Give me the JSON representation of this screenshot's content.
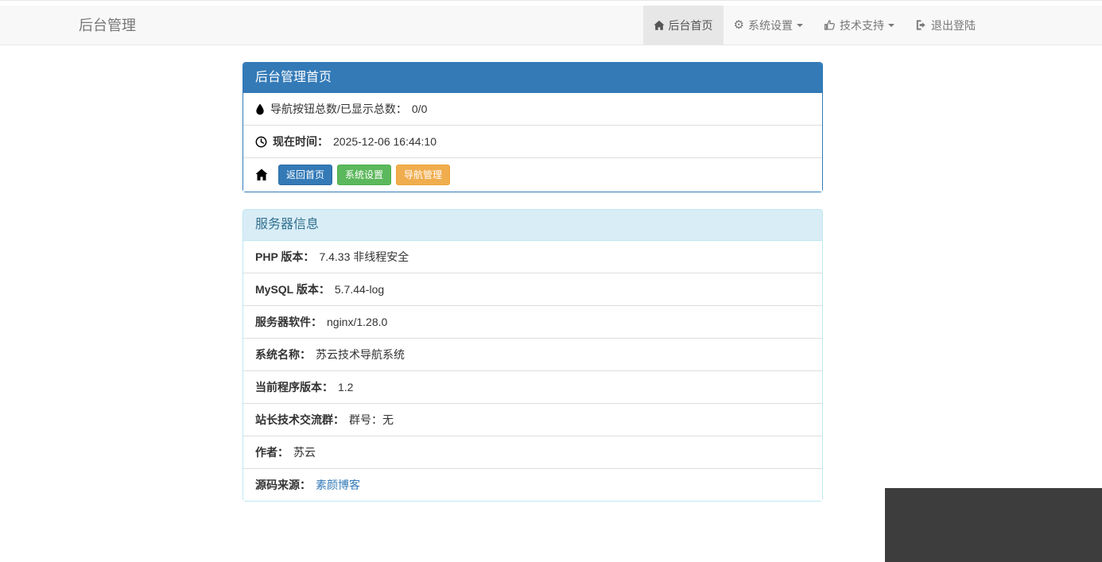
{
  "navbar": {
    "brand": "后台管理",
    "items": [
      {
        "label": "后台首页",
        "icon": "home-icon",
        "active": true,
        "has_dropdown": false
      },
      {
        "label": "系统设置",
        "icon": "gear-icon",
        "active": false,
        "has_dropdown": true
      },
      {
        "label": "技术支持",
        "icon": "thumbs-up-icon",
        "active": false,
        "has_dropdown": true
      },
      {
        "label": "退出登陆",
        "icon": "sign-out-icon",
        "active": false,
        "has_dropdown": false
      }
    ]
  },
  "panels": [
    {
      "title": "后台管理首页",
      "style": "primary",
      "rows": [
        {
          "icon": "tint-icon",
          "label": "导航按钮总数/已显示总数：",
          "value": "0/0"
        },
        {
          "icon": "clock-icon",
          "label": "现在时间：",
          "value": "2025-12-06 16:44:10"
        },
        {
          "icon": "home-icon",
          "buttons": [
            {
              "label": "返回首页",
              "style": "primary"
            },
            {
              "label": "系统设置",
              "style": "success"
            },
            {
              "label": "导航管理",
              "style": "warning"
            }
          ]
        }
      ]
    },
    {
      "title": "服务器信息",
      "style": "info",
      "rows": [
        {
          "label": "PHP 版本：",
          "value": "7.4.33 非线程安全"
        },
        {
          "label": "MySQL 版本：",
          "value": "5.7.44-log"
        },
        {
          "label": "服务器软件：",
          "value": "nginx/1.28.0"
        },
        {
          "label": "系统名称：",
          "value": "苏云技术导航系统"
        },
        {
          "label": "当前程序版本：",
          "value": "1.2"
        },
        {
          "label": "站长技术交流群：",
          "value": "群号：无"
        },
        {
          "label": "作者：",
          "value": "苏云"
        },
        {
          "label": "源码来源：",
          "value": "素颜博客",
          "is_link": true
        }
      ]
    }
  ],
  "colors": {
    "accent_primary": "#337ab7",
    "accent_success": "#5cb85c",
    "accent_warning": "#f0ad4e",
    "panel_info_header_bg": "#d9edf7",
    "panel_info_header_text": "#31708f",
    "navbar_bg": "#f8f8f8",
    "navbar_active_bg": "#e7e7e7",
    "desktop_corner": "#3d3d3d",
    "link": "#337ab7"
  }
}
